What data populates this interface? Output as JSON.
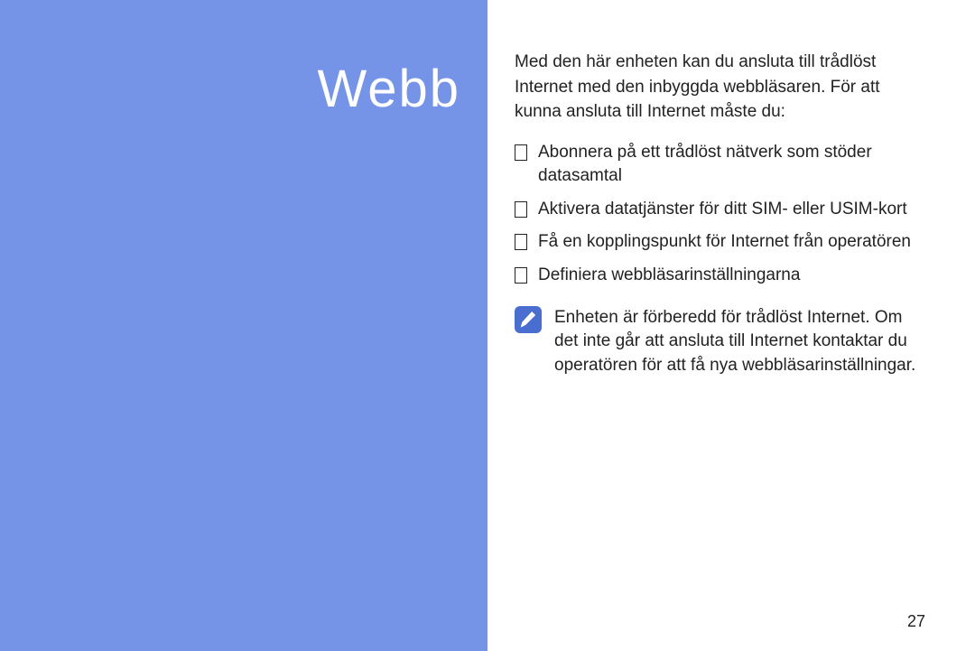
{
  "sidebar": {
    "title": "Webb"
  },
  "content": {
    "intro": "Med den här enheten kan du ansluta till trådlöst Internet med den inbyggda webbläsaren. För att kunna ansluta till Internet måste du:",
    "bullets": [
      "Abonnera på ett trådlöst nätverk som stöder datasamtal",
      "Aktivera datatjänster för ditt SIM- eller USIM-kort",
      "Få en kopplingspunkt för Internet från operatören",
      "Definiera webbläsarinställningarna"
    ],
    "note": "Enheten är förberedd för trådlöst Internet. Om det inte går att ansluta till Internet kontaktar du operatören för att få nya webbläsarinställningar."
  },
  "page_number": "27"
}
